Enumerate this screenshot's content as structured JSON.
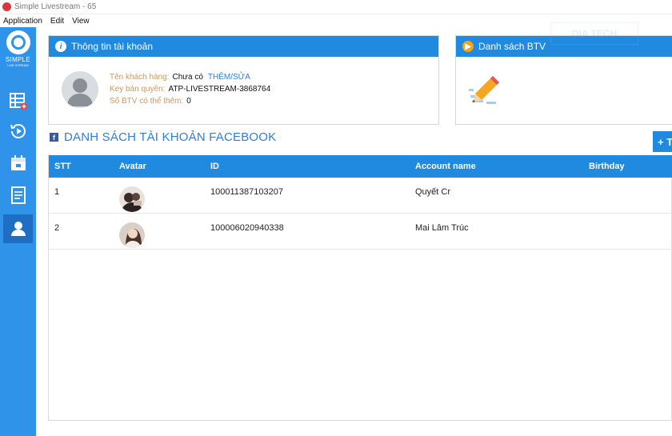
{
  "window": {
    "title": "Simple Livestream - 65"
  },
  "menu": [
    "Application",
    "Edit",
    "View"
  ],
  "sidebar": {
    "brand": "SIMPLE",
    "brand_sub": "LIVE STREAM",
    "items": [
      {
        "icon": "table-add-icon"
      },
      {
        "icon": "history-icon"
      },
      {
        "icon": "calendar-icon"
      },
      {
        "icon": "document-icon"
      },
      {
        "icon": "user-icon",
        "active": true
      }
    ]
  },
  "account_panel": {
    "title": "Thông tin tài khoản",
    "customer_label": "Tên khách hàng:",
    "customer_value": "Chưa có",
    "customer_link": "THÊM/SỬA",
    "key_label": "Key bản quyền:",
    "key_value": "ATP-LIVESTREAM-3868764",
    "btv_label": "Số BTV có thể thêm:",
    "btv_value": "0"
  },
  "btv_panel": {
    "title": "Danh sách BTV"
  },
  "facebook": {
    "title": "DANH SÁCH TÀI KHOẢN FACEBOOK",
    "add_button": "+ T",
    "columns": [
      "STT",
      "Avatar",
      "ID",
      "Account name",
      "Birthday"
    ],
    "rows": [
      {
        "stt": "1",
        "id": "100011387103207",
        "name": "Quyết Cr",
        "birthday": ""
      },
      {
        "stt": "2",
        "id": "100006020940338",
        "name": "Mai Lâm Trúc",
        "birthday": ""
      }
    ]
  },
  "watermark": "DIA TECH",
  "colors": {
    "accent": "#1f8ae0",
    "sidebar": "#2f93e9",
    "label": "#c89a60",
    "link": "#2f7fd1"
  }
}
